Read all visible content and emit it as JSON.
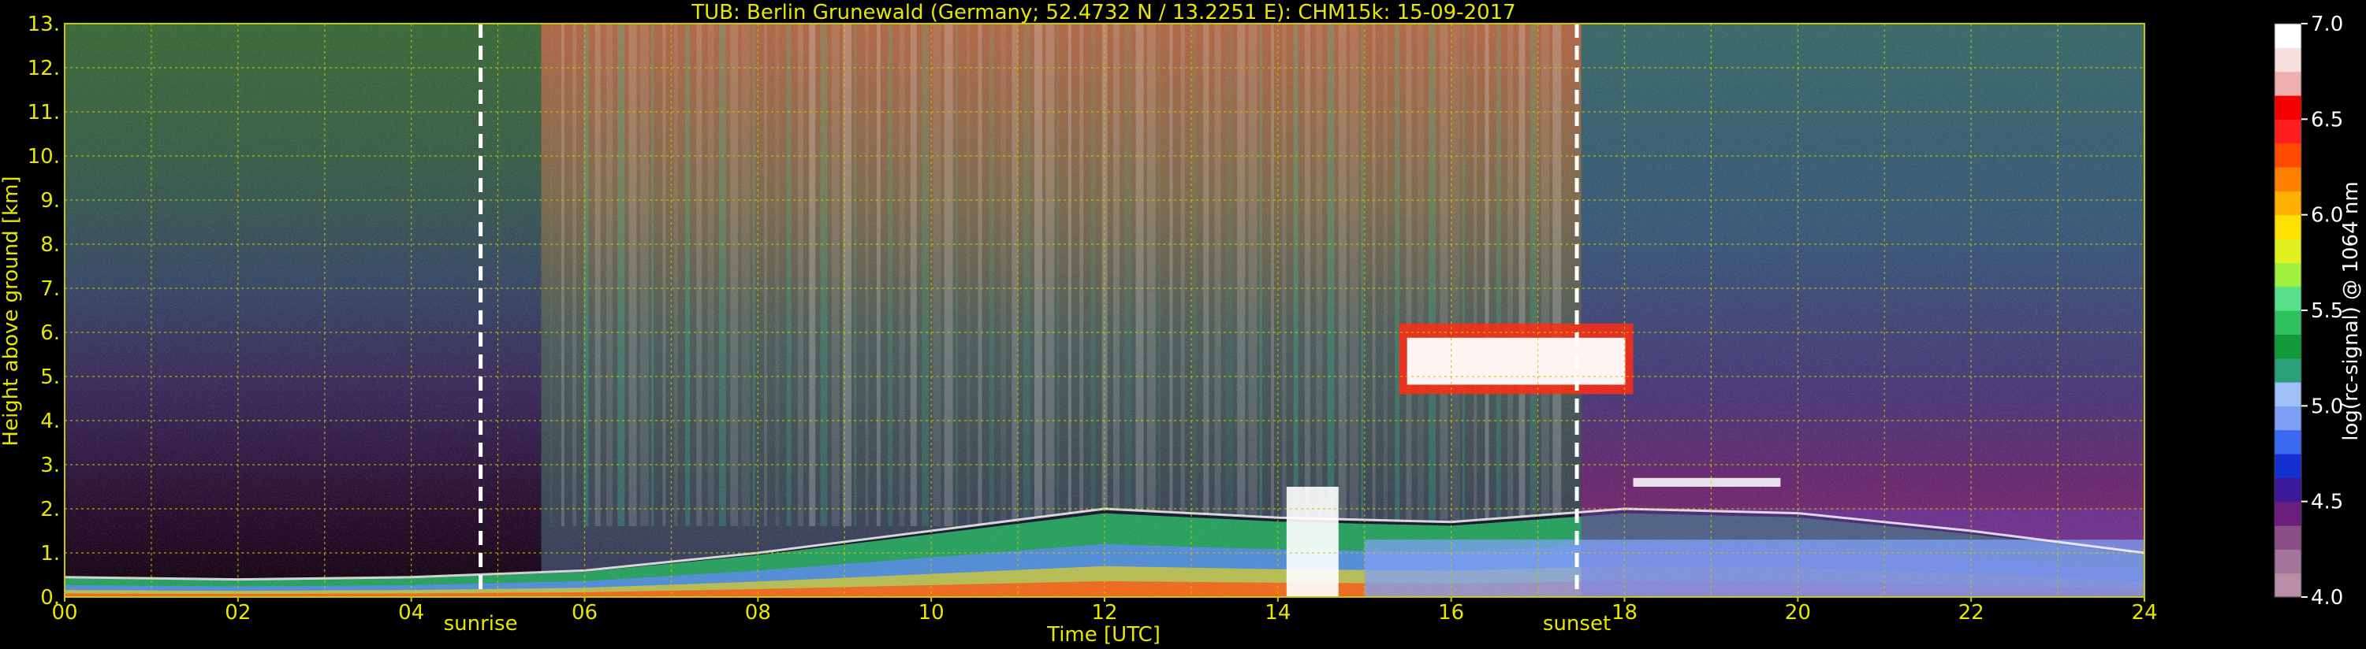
{
  "chart_data": {
    "type": "heatmap",
    "title": "TUB: Berlin Grunewald (Germany; 52.4732 N / 13.2251 E):    CHM15k: 15-09-2017",
    "xlabel": "Time [UTC]",
    "ylabel": "Height above ground [km]",
    "xlim": [
      0,
      24
    ],
    "ylim": [
      0,
      13
    ],
    "x_ticks": [
      "00",
      "02",
      "04",
      "06",
      "08",
      "10",
      "12",
      "14",
      "16",
      "18",
      "20",
      "22",
      "24"
    ],
    "y_ticks": [
      "0.",
      "1.",
      "2.",
      "3.",
      "4.",
      "5.",
      "6.",
      "7.",
      "8.",
      "9.",
      "10.",
      "11.",
      "12.",
      "13."
    ],
    "grid": true,
    "colorbar": {
      "label": "log(rc-signal) @ 1064 nm",
      "range": [
        4.0,
        7.0
      ],
      "ticks": [
        "4.0",
        "4.5",
        "5.0",
        "5.5",
        "6.0",
        "6.5",
        "7.0"
      ],
      "colors": [
        "#b98ea9",
        "#a4749a",
        "#8a4f86",
        "#6a1d7a",
        "#3a1a9a",
        "#1530d0",
        "#3a6af0",
        "#7f9ff5",
        "#a0c0f8",
        "#2aa07a",
        "#109a3a",
        "#30c060",
        "#5ae08a",
        "#a0f040",
        "#e0f020",
        "#ffe000",
        "#ffb000",
        "#ff8000",
        "#ff4a00",
        "#ff1e1e",
        "#f50000",
        "#f0b0b0",
        "#f8e0e0",
        "#ffffff"
      ]
    },
    "markers": [
      {
        "label": "sunrise",
        "time": 4.8
      },
      {
        "label": "sunset",
        "time": 17.45
      }
    ],
    "features": [
      {
        "name": "boundary layer",
        "time_range": [
          0,
          24
        ],
        "top_km_at": [
          [
            0,
            0.45
          ],
          [
            2,
            0.4
          ],
          [
            4,
            0.45
          ],
          [
            6,
            0.6
          ],
          [
            8,
            1.0
          ],
          [
            10,
            1.5
          ],
          [
            12,
            2.0
          ],
          [
            14,
            1.8
          ],
          [
            16,
            1.7
          ],
          [
            18,
            2.0
          ],
          [
            20,
            1.9
          ],
          [
            22,
            1.5
          ],
          [
            24,
            1.0
          ]
        ]
      },
      {
        "name": "cloud layer",
        "time_range": [
          15.4,
          18.1
        ],
        "height_km": [
          4.6,
          6.2
        ]
      },
      {
        "name": "elevated layer",
        "time_range": [
          18.1,
          19.8
        ],
        "height_km": [
          2.5,
          2.7
        ]
      },
      {
        "name": "rain/fall streak",
        "time_range": [
          14.1,
          14.7
        ],
        "height_km": [
          0,
          2.5
        ]
      }
    ]
  }
}
